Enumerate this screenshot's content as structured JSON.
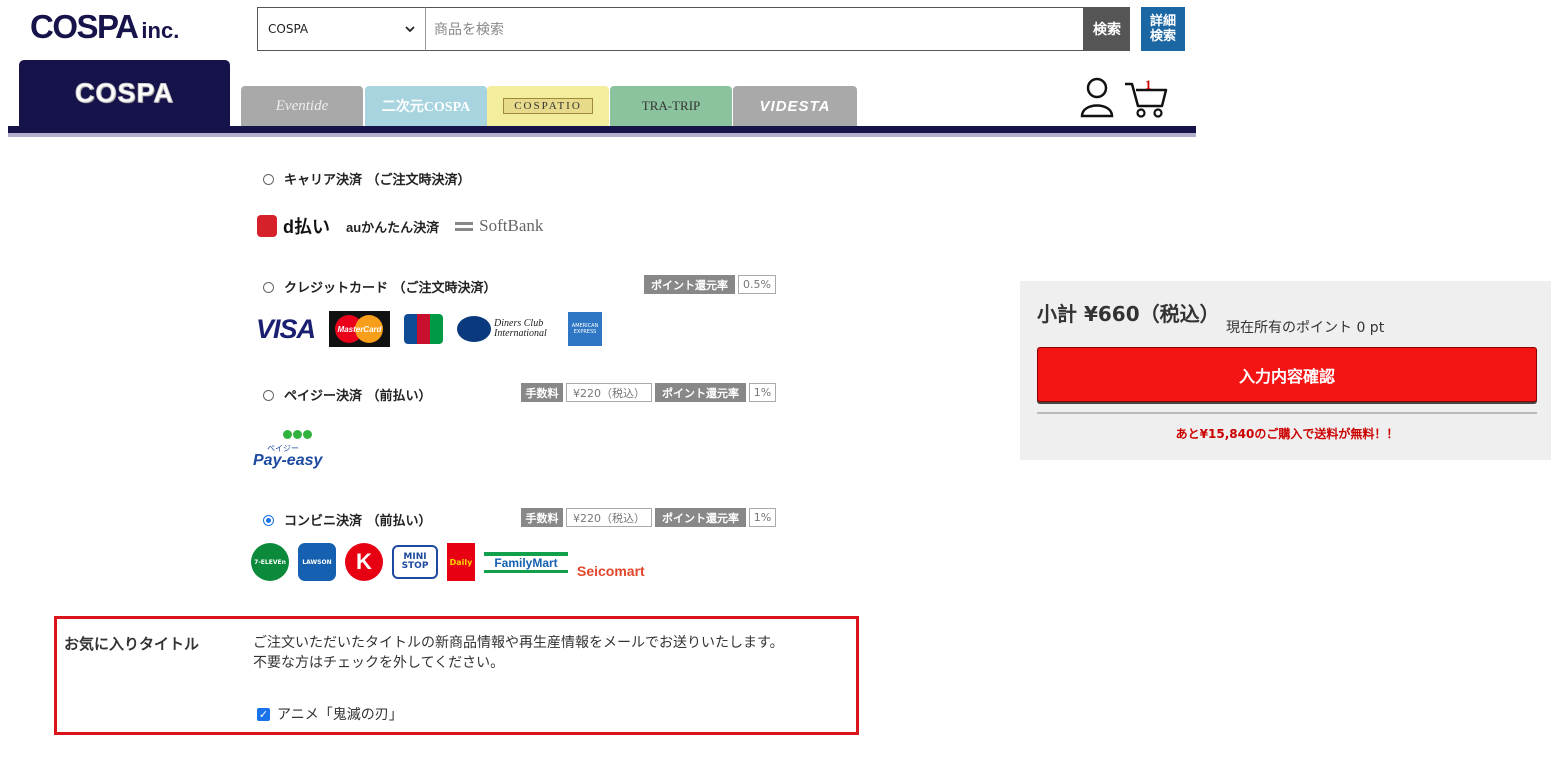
{
  "header": {
    "logo": "COSPA",
    "logo_suffix": "inc.",
    "search_category": "COSPA",
    "search_placeholder": "商品を検索",
    "search_button": "検索",
    "advanced_search": "詳細\n検索"
  },
  "brand_tabs": [
    {
      "label": "COSPA"
    },
    {
      "label": "Eventide"
    },
    {
      "label": "二次元COSPA"
    },
    {
      "label": "COSPATIO"
    },
    {
      "label": "TRA-TRIP"
    },
    {
      "label": "VIDESTA"
    }
  ],
  "cart": {
    "count": "1"
  },
  "payment_options": [
    {
      "label": "キャリア決済 （ご注文時決済）",
      "selected": false,
      "brands": [
        "d払い",
        "auかんたん決済",
        "SoftBank"
      ]
    },
    {
      "label": "クレジットカード （ご注文時決済）",
      "selected": false,
      "point_label": "ポイント還元率",
      "point_value": "0.5%",
      "brands": [
        "VISA",
        "MasterCard",
        "JCB",
        "Diners Club International",
        "AMERICAN EXPRESS"
      ]
    },
    {
      "label": "ペイジー決済 （前払い）",
      "selected": false,
      "fee_label": "手数料",
      "fee_value": "¥220（税込）",
      "point_label": "ポイント還元率",
      "point_value": "1%",
      "brands": [
        "Pay-easy",
        "ペイジー"
      ]
    },
    {
      "label": "コンビニ決済 （前払い）",
      "selected": true,
      "fee_label": "手数料",
      "fee_value": "¥220（税込）",
      "point_label": "ポイント還元率",
      "point_value": "1%",
      "brands": [
        "7-ELEVEn",
        "LAWSON",
        "K",
        "MINI STOP",
        "Daily",
        "FamilyMart",
        "Seicomart"
      ]
    }
  ],
  "summary": {
    "subtotal": "小計 ¥660（税込）",
    "points": "現在所有のポイント 0 pt",
    "confirm_button": "入力内容確認",
    "shipping_note": "あと¥15,840のご購入で送料が無料！！"
  },
  "favorite": {
    "title": "お気に入りタイトル",
    "description_1": "ご注文いただいたタイトルの新商品情報や再生産情報をメールでお送りいたします。",
    "description_2": "不要な方はチェックを外してください。",
    "checkbox_label": "アニメ「鬼滅の刃」",
    "checked": true
  },
  "colors": {
    "brand_navy": "#16124a",
    "confirm_red": "#f41414",
    "highlight_border": "#d9141a",
    "search_button": "#555555",
    "advanced_button": "#1a67a3"
  }
}
